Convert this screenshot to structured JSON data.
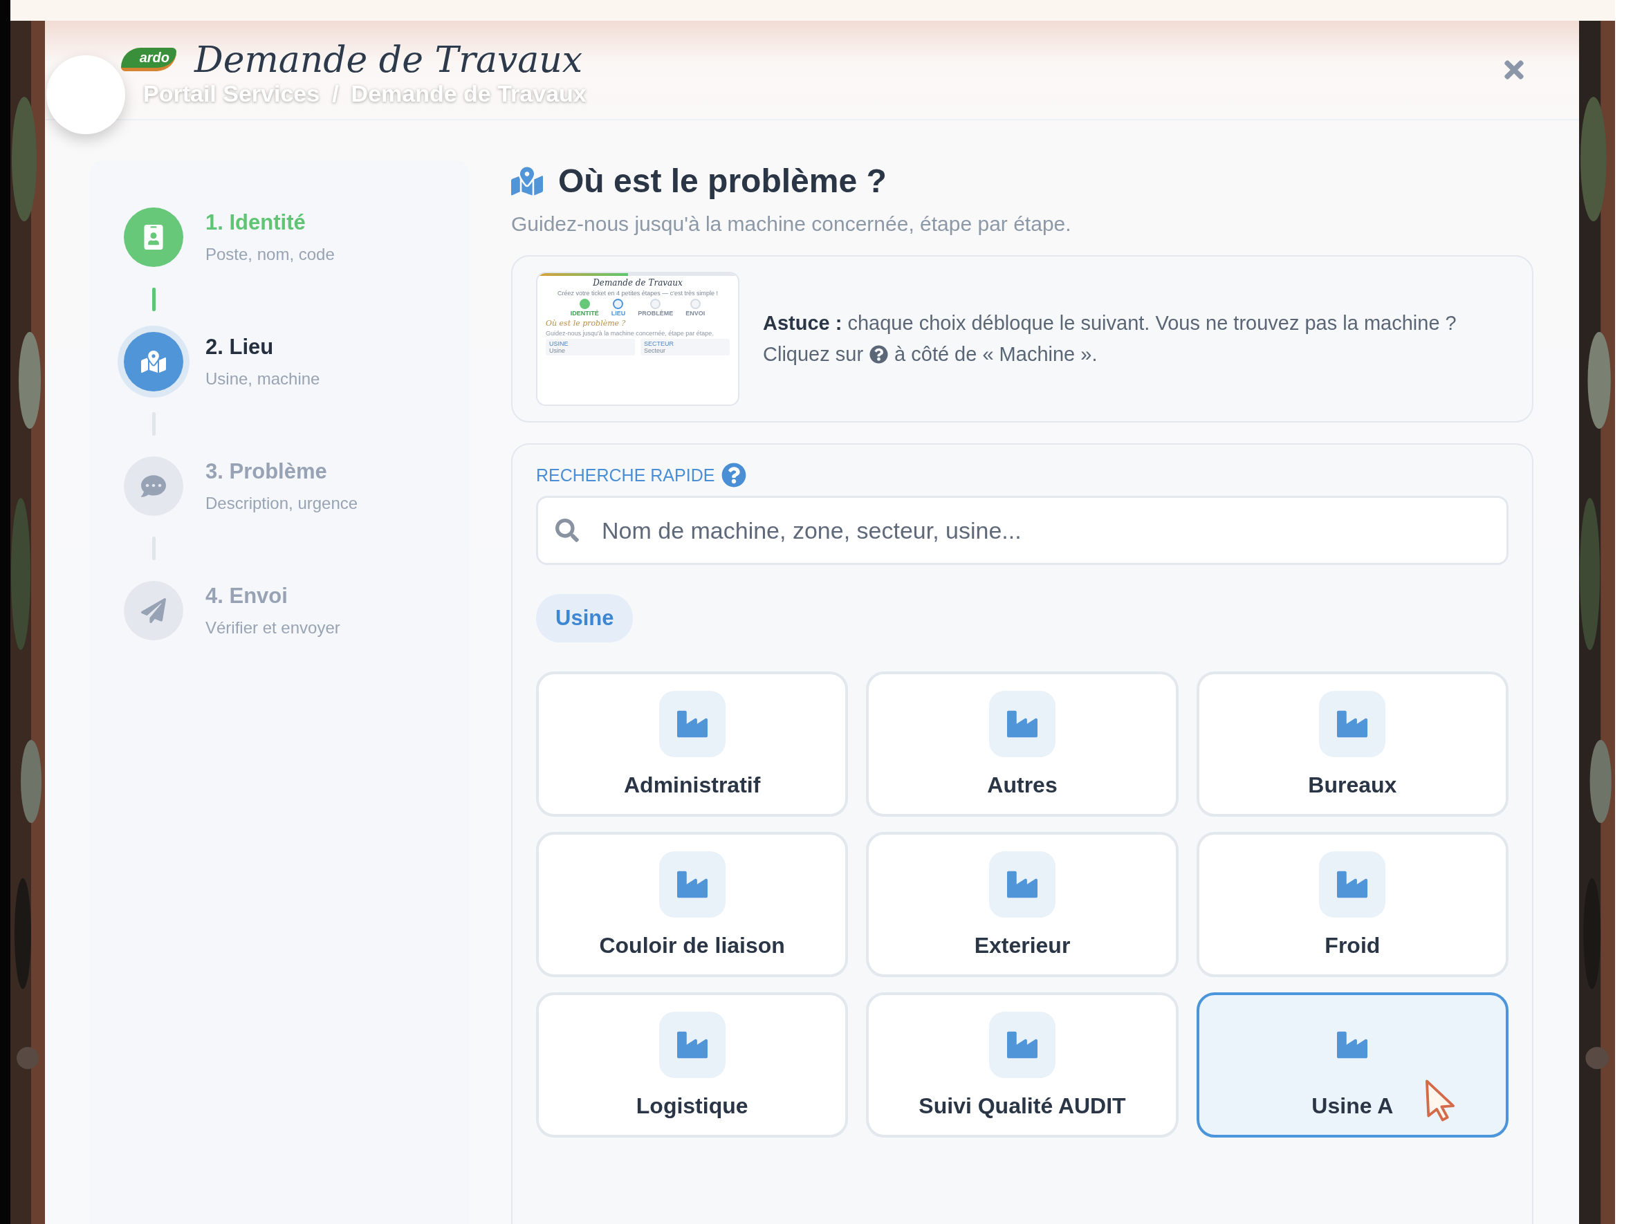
{
  "header": {
    "logo_text": "ardo",
    "title": "Demande de Travaux",
    "breadcrumb": [
      "Portail Services",
      "Demande de Travaux"
    ],
    "breadcrumb_separator": "/"
  },
  "steps": [
    {
      "title": "1. Identité",
      "subtitle": "Poste, nom, code",
      "done": true,
      "selected": false
    },
    {
      "title": "2. Lieu",
      "subtitle": "Usine, machine",
      "done": false,
      "selected": true
    },
    {
      "title": "3. Problème",
      "subtitle": "Description, urgence",
      "done": false,
      "selected": false
    },
    {
      "title": "4. Envoi",
      "subtitle": "Vérifier et envoyer",
      "done": false,
      "selected": false
    }
  ],
  "section": {
    "title": "Où est le problème ?",
    "subtitle": "Guidez-nous jusqu'à la machine concernée, étape par étape."
  },
  "tip": {
    "text_line1": "**Astuce :** chaque choix débloque le suivant. Vous ne trouvez pas la machine ?",
    "text_before_icon": "Cliquez sur",
    "text_after_icon": "à côté de « Machine ».",
    "thumbnail": {
      "level": 0.45,
      "title": "Demande de Travaux",
      "tagline": "Créez votre ticket en 4 petites étapes — c'est très simple !",
      "steps": [
        {
          "label": "IDENTITÉ",
          "done": true,
          "selected": false
        },
        {
          "label": "LIEU",
          "done": false,
          "selected": true
        },
        {
          "label": "PROBLÈME",
          "done": false,
          "selected": false
        },
        {
          "label": "ENVOI",
          "done": false,
          "selected": false
        }
      ],
      "heading": "Où est le problème ?",
      "subtitle": "Guidez-nous jusqu'à la machine concernée, étape par étape.",
      "fields": [
        {
          "label": "USINE",
          "placeholder": "Usine"
        },
        {
          "label": "SECTEUR",
          "placeholder": "Secteur"
        }
      ]
    }
  },
  "search": {
    "label": "RECHERCHE RAPIDE",
    "placeholder": "Nom de machine, zone, secteur, usine..."
  },
  "filter_chip": {
    "label": "Usine"
  },
  "cards": [
    {
      "label": "Administratif",
      "selected": false
    },
    {
      "label": "Autres",
      "selected": false
    },
    {
      "label": "Bureaux",
      "selected": false
    },
    {
      "label": "Couloir de liaison",
      "selected": false
    },
    {
      "label": "Exterieur",
      "selected": false
    },
    {
      "label": "Froid",
      "selected": false
    },
    {
      "label": "Logistique",
      "selected": false
    },
    {
      "label": "Suivi Qualité AUDIT",
      "selected": false
    },
    {
      "label": "Usine A",
      "selected": true
    }
  ]
}
